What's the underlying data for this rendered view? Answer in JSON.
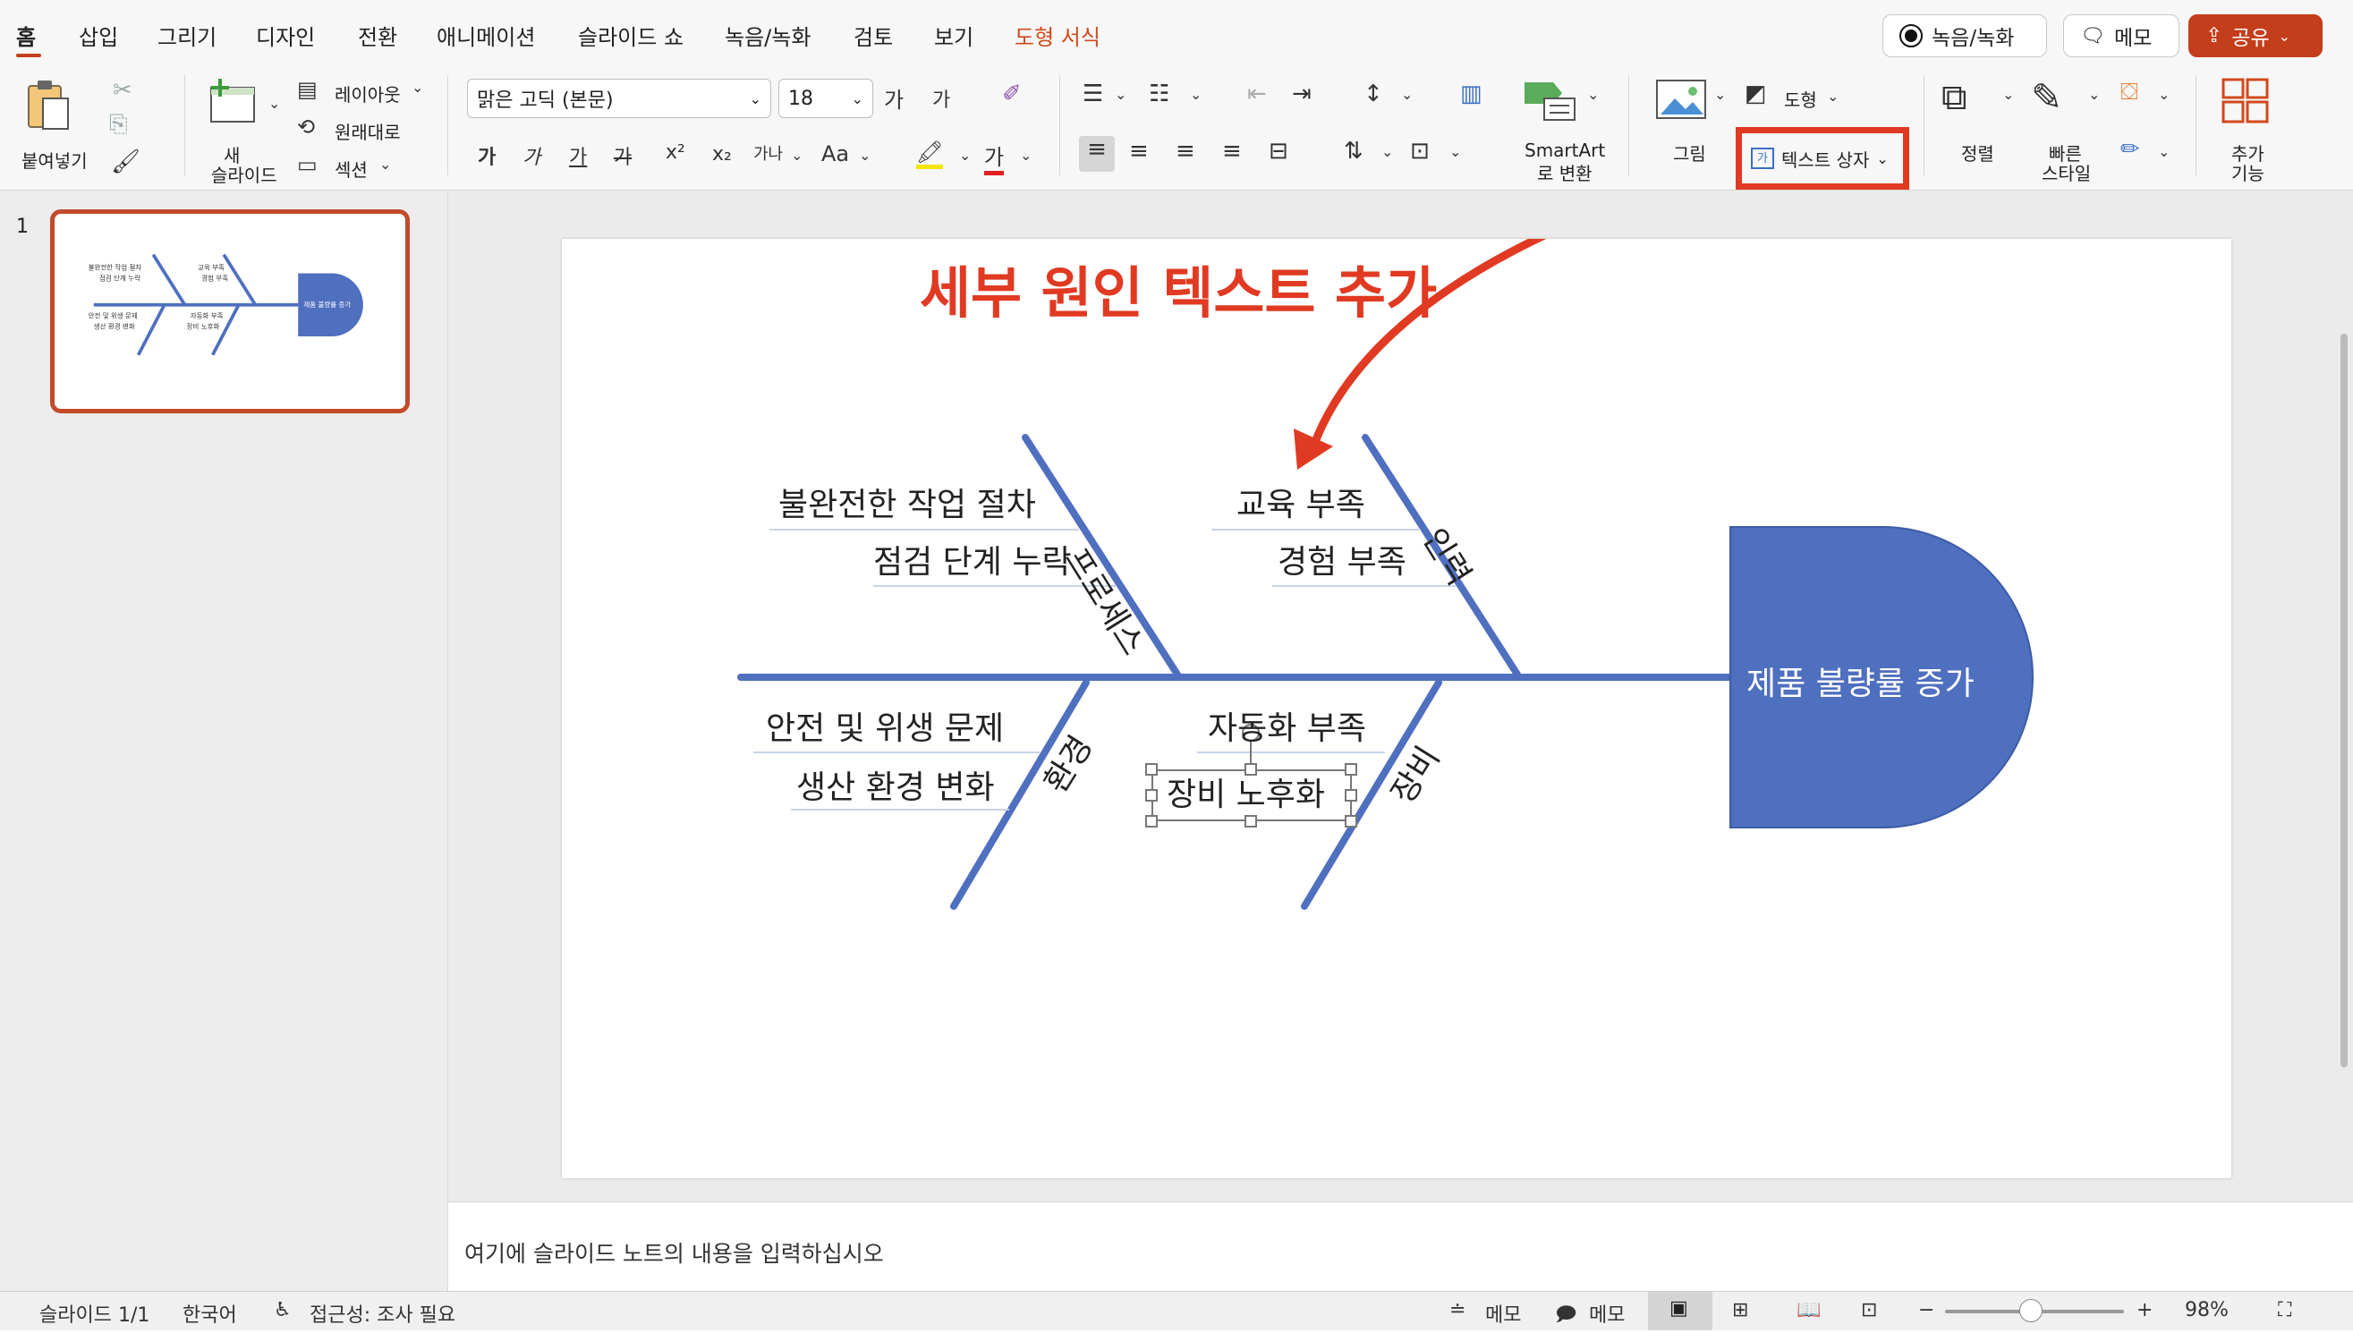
{
  "tabs": [
    "홈",
    "삽입",
    "그리기",
    "디자인",
    "전환",
    "애니메이션",
    "슬라이드 쇼",
    "녹음/녹화",
    "검토",
    "보기",
    "도형 서식"
  ],
  "top_buttons": {
    "record": "녹음/녹화",
    "comment": "메모",
    "share": "공유"
  },
  "ribbon": {
    "paste": "붙여넣기",
    "new_slide_line1": "새",
    "new_slide_line2": "슬라이드",
    "layout": "레이아웃",
    "reset": "원래대로",
    "section": "섹션",
    "font_name": "맑은 고딕 (본문)",
    "font_size": "18",
    "grow_font": "가",
    "shrink_font": "가",
    "bold": "가",
    "italic": "가",
    "underline": "가",
    "strike": "가",
    "superscript": "x²",
    "subscript": "x₂",
    "char_spacing": "가나",
    "change_case": "Aa",
    "font_color_letter": "가",
    "smartart_line1": "SmartArt",
    "smartart_line2": "로 변환",
    "picture": "그림",
    "shape": "도형",
    "textbox": "텍스트 상자",
    "arrange": "정렬",
    "quick_styles_line1": "빠른",
    "quick_styles_line2": "스타일",
    "addins_line1": "추가",
    "addins_line2": "기능"
  },
  "slide_number": "1",
  "slide": {
    "annotation_title": "세부 원인 텍스트 추가",
    "head_label": "제품 불량률 증가",
    "categories": [
      "프로세스",
      "인력",
      "환경",
      "장비"
    ],
    "causes": {
      "process": [
        "불완전한 작업 절차",
        "점검 단계 누락"
      ],
      "people": [
        "교육 부족",
        "경험 부족"
      ],
      "environment": [
        "안전 및 위생 문제",
        "생산 환경 변화"
      ],
      "equipment": [
        "자동화 부족",
        "장비 노후화"
      ]
    }
  },
  "notes_placeholder": "여기에 슬라이드 노트의 내용을 입력하십시오",
  "status": {
    "slide_count": "슬라이드 1/1",
    "language": "한국어",
    "accessibility": "접근성: 조사 필요",
    "notes": "메모",
    "comments": "메모",
    "zoom": "98%"
  },
  "colors": {
    "accent": "#c43e1c",
    "shape_blue": "#4f6fbf",
    "annotation_red": "#e03a22"
  }
}
